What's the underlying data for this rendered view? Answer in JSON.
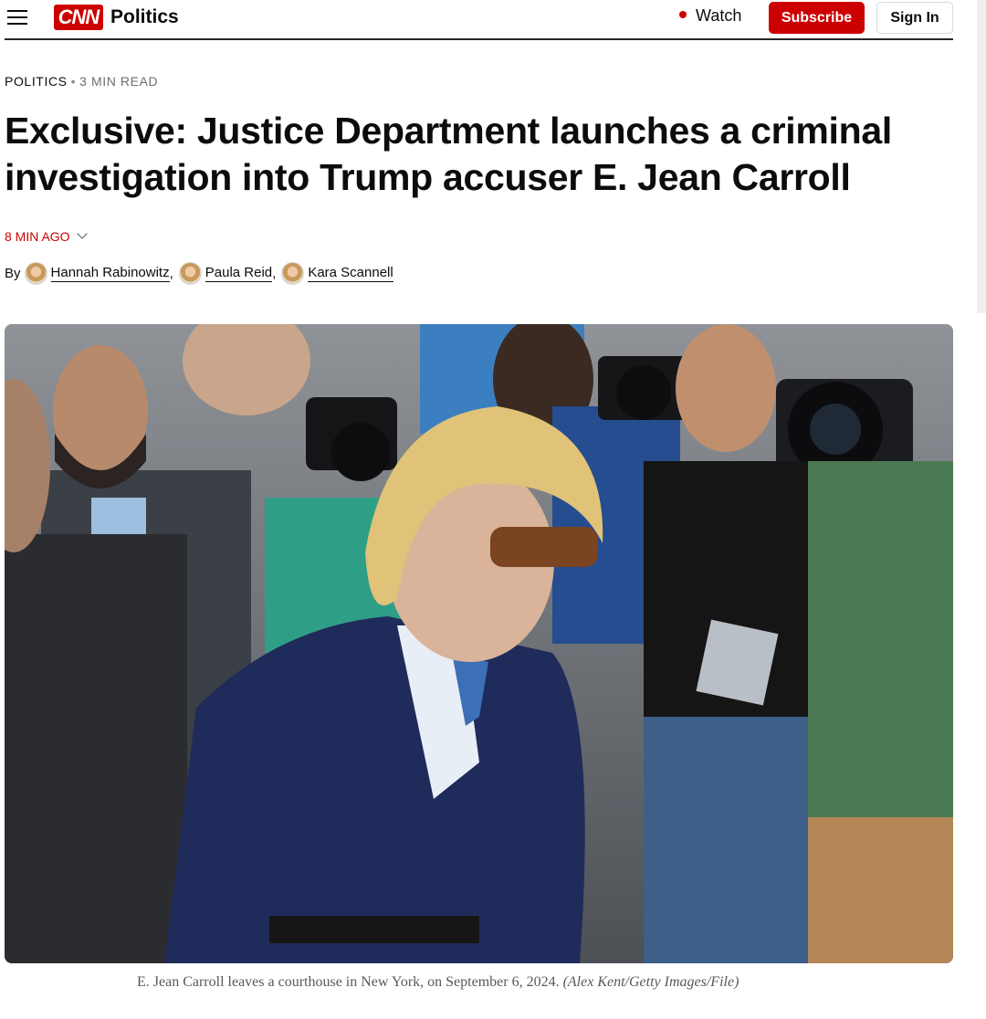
{
  "header": {
    "logo_text": "CNN",
    "section": "Politics",
    "watch_label": "Watch",
    "subscribe_label": "Subscribe",
    "signin_label": "Sign In"
  },
  "article": {
    "kicker": "POLITICS",
    "read_time": "3 MIN READ",
    "headline": "Exclusive: Justice Department launches a criminal investigation into Trump accuser E. Jean Carroll",
    "timestamp": "8 MIN AGO",
    "byline_prefix": "By",
    "authors": [
      {
        "name": "Hannah Rabinowitz"
      },
      {
        "name": "Paula Reid"
      },
      {
        "name": "Kara Scannell"
      }
    ],
    "caption": {
      "text": "E. Jean Carroll leaves a courthouse in New York, on September 6, 2024.",
      "credit": "(Alex Kent/Getty Images/File)"
    }
  },
  "colors": {
    "brand_red": "#cc0000",
    "text": "#0c0c0c",
    "caption_gray": "#595959"
  },
  "icons": {
    "menu": "hamburger-icon",
    "timestamp_toggle": "chevron-down-icon"
  }
}
